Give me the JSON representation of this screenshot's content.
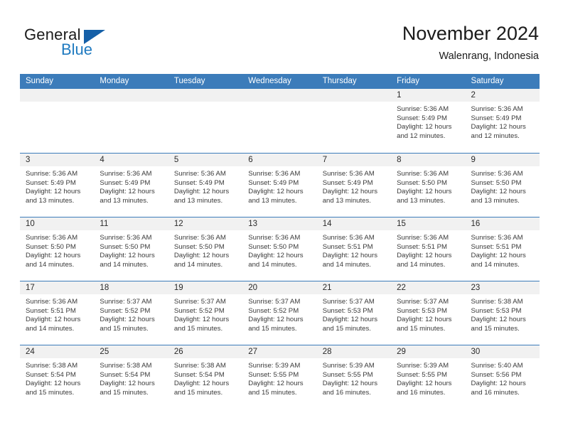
{
  "brand": {
    "name_part1": "General",
    "name_part2": "Blue",
    "flag_icon": "triangle-flag-icon"
  },
  "header": {
    "title": "November 2024",
    "subtitle": "Walenrang, Indonesia"
  },
  "colors": {
    "header_blue": "#3c7cba",
    "brand_blue": "#1f7ac0",
    "flag_blue": "#1560a8",
    "day_band_gray": "#f1f1f1",
    "text": "#222222"
  },
  "calendar": {
    "weekdays": [
      "Sunday",
      "Monday",
      "Tuesday",
      "Wednesday",
      "Thursday",
      "Friday",
      "Saturday"
    ],
    "weeks": [
      [
        {
          "day": "",
          "empty": true
        },
        {
          "day": "",
          "empty": true
        },
        {
          "day": "",
          "empty": true
        },
        {
          "day": "",
          "empty": true
        },
        {
          "day": "",
          "empty": true
        },
        {
          "day": "1",
          "sunrise": "Sunrise: 5:36 AM",
          "sunset": "Sunset: 5:49 PM",
          "daylight": "Daylight: 12 hours and 12 minutes."
        },
        {
          "day": "2",
          "sunrise": "Sunrise: 5:36 AM",
          "sunset": "Sunset: 5:49 PM",
          "daylight": "Daylight: 12 hours and 12 minutes."
        }
      ],
      [
        {
          "day": "3",
          "sunrise": "Sunrise: 5:36 AM",
          "sunset": "Sunset: 5:49 PM",
          "daylight": "Daylight: 12 hours and 13 minutes."
        },
        {
          "day": "4",
          "sunrise": "Sunrise: 5:36 AM",
          "sunset": "Sunset: 5:49 PM",
          "daylight": "Daylight: 12 hours and 13 minutes."
        },
        {
          "day": "5",
          "sunrise": "Sunrise: 5:36 AM",
          "sunset": "Sunset: 5:49 PM",
          "daylight": "Daylight: 12 hours and 13 minutes."
        },
        {
          "day": "6",
          "sunrise": "Sunrise: 5:36 AM",
          "sunset": "Sunset: 5:49 PM",
          "daylight": "Daylight: 12 hours and 13 minutes."
        },
        {
          "day": "7",
          "sunrise": "Sunrise: 5:36 AM",
          "sunset": "Sunset: 5:49 PM",
          "daylight": "Daylight: 12 hours and 13 minutes."
        },
        {
          "day": "8",
          "sunrise": "Sunrise: 5:36 AM",
          "sunset": "Sunset: 5:50 PM",
          "daylight": "Daylight: 12 hours and 13 minutes."
        },
        {
          "day": "9",
          "sunrise": "Sunrise: 5:36 AM",
          "sunset": "Sunset: 5:50 PM",
          "daylight": "Daylight: 12 hours and 13 minutes."
        }
      ],
      [
        {
          "day": "10",
          "sunrise": "Sunrise: 5:36 AM",
          "sunset": "Sunset: 5:50 PM",
          "daylight": "Daylight: 12 hours and 14 minutes."
        },
        {
          "day": "11",
          "sunrise": "Sunrise: 5:36 AM",
          "sunset": "Sunset: 5:50 PM",
          "daylight": "Daylight: 12 hours and 14 minutes."
        },
        {
          "day": "12",
          "sunrise": "Sunrise: 5:36 AM",
          "sunset": "Sunset: 5:50 PM",
          "daylight": "Daylight: 12 hours and 14 minutes."
        },
        {
          "day": "13",
          "sunrise": "Sunrise: 5:36 AM",
          "sunset": "Sunset: 5:50 PM",
          "daylight": "Daylight: 12 hours and 14 minutes."
        },
        {
          "day": "14",
          "sunrise": "Sunrise: 5:36 AM",
          "sunset": "Sunset: 5:51 PM",
          "daylight": "Daylight: 12 hours and 14 minutes."
        },
        {
          "day": "15",
          "sunrise": "Sunrise: 5:36 AM",
          "sunset": "Sunset: 5:51 PM",
          "daylight": "Daylight: 12 hours and 14 minutes."
        },
        {
          "day": "16",
          "sunrise": "Sunrise: 5:36 AM",
          "sunset": "Sunset: 5:51 PM",
          "daylight": "Daylight: 12 hours and 14 minutes."
        }
      ],
      [
        {
          "day": "17",
          "sunrise": "Sunrise: 5:36 AM",
          "sunset": "Sunset: 5:51 PM",
          "daylight": "Daylight: 12 hours and 14 minutes."
        },
        {
          "day": "18",
          "sunrise": "Sunrise: 5:37 AM",
          "sunset": "Sunset: 5:52 PM",
          "daylight": "Daylight: 12 hours and 15 minutes."
        },
        {
          "day": "19",
          "sunrise": "Sunrise: 5:37 AM",
          "sunset": "Sunset: 5:52 PM",
          "daylight": "Daylight: 12 hours and 15 minutes."
        },
        {
          "day": "20",
          "sunrise": "Sunrise: 5:37 AM",
          "sunset": "Sunset: 5:52 PM",
          "daylight": "Daylight: 12 hours and 15 minutes."
        },
        {
          "day": "21",
          "sunrise": "Sunrise: 5:37 AM",
          "sunset": "Sunset: 5:53 PM",
          "daylight": "Daylight: 12 hours and 15 minutes."
        },
        {
          "day": "22",
          "sunrise": "Sunrise: 5:37 AM",
          "sunset": "Sunset: 5:53 PM",
          "daylight": "Daylight: 12 hours and 15 minutes."
        },
        {
          "day": "23",
          "sunrise": "Sunrise: 5:38 AM",
          "sunset": "Sunset: 5:53 PM",
          "daylight": "Daylight: 12 hours and 15 minutes."
        }
      ],
      [
        {
          "day": "24",
          "sunrise": "Sunrise: 5:38 AM",
          "sunset": "Sunset: 5:54 PM",
          "daylight": "Daylight: 12 hours and 15 minutes."
        },
        {
          "day": "25",
          "sunrise": "Sunrise: 5:38 AM",
          "sunset": "Sunset: 5:54 PM",
          "daylight": "Daylight: 12 hours and 15 minutes."
        },
        {
          "day": "26",
          "sunrise": "Sunrise: 5:38 AM",
          "sunset": "Sunset: 5:54 PM",
          "daylight": "Daylight: 12 hours and 15 minutes."
        },
        {
          "day": "27",
          "sunrise": "Sunrise: 5:39 AM",
          "sunset": "Sunset: 5:55 PM",
          "daylight": "Daylight: 12 hours and 15 minutes."
        },
        {
          "day": "28",
          "sunrise": "Sunrise: 5:39 AM",
          "sunset": "Sunset: 5:55 PM",
          "daylight": "Daylight: 12 hours and 16 minutes."
        },
        {
          "day": "29",
          "sunrise": "Sunrise: 5:39 AM",
          "sunset": "Sunset: 5:55 PM",
          "daylight": "Daylight: 12 hours and 16 minutes."
        },
        {
          "day": "30",
          "sunrise": "Sunrise: 5:40 AM",
          "sunset": "Sunset: 5:56 PM",
          "daylight": "Daylight: 12 hours and 16 minutes."
        }
      ]
    ]
  }
}
